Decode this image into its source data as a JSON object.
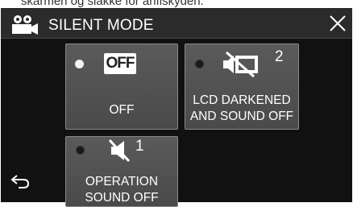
{
  "caption": "skärmen og slakke för anfiskyden.",
  "header": {
    "title": "SILENT MODE",
    "mode_icon": "movie-camera-icon",
    "close_icon": "close-icon"
  },
  "options": {
    "off": {
      "badge": "OFF",
      "label": "OFF",
      "selected": true
    },
    "lcd": {
      "superscript": "2",
      "label": "LCD DARKENED\nAND SOUND OFF",
      "icon": "screen-speaker-off-icon",
      "selected": false
    },
    "operation": {
      "superscript": "1",
      "label": "OPERATION\nSOUND OFF",
      "icon": "speaker-muted-icon",
      "selected": false
    }
  },
  "footer": {
    "back_icon": "return-arrow-icon"
  },
  "colors": {
    "screen_bg": "#111111",
    "button_bg": "#555555",
    "button_border": "#8a8a8a",
    "text": "#ffffff"
  }
}
